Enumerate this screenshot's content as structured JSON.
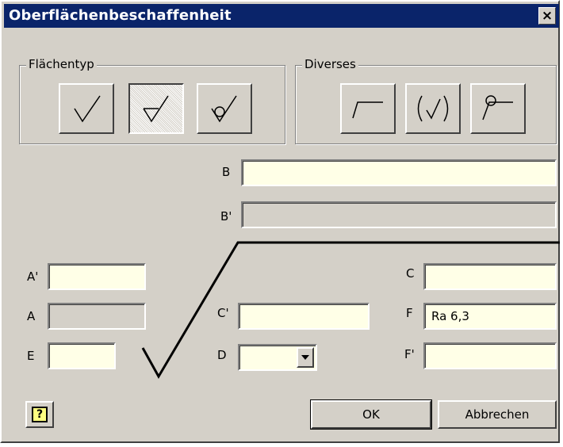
{
  "window": {
    "title": "Oberflächenbeschaffenheit",
    "close_label": "×"
  },
  "groups": {
    "surface_type": {
      "legend": "Flächentyp",
      "buttons": [
        {
          "icon": "basic-surface-symbol-icon",
          "pressed": false
        },
        {
          "icon": "material-removal-required-icon",
          "pressed": true
        },
        {
          "icon": "material-removal-prohibited-icon",
          "pressed": false
        }
      ]
    },
    "misc": {
      "legend": "Diverses",
      "buttons": [
        {
          "icon": "long-leg-symbol-icon"
        },
        {
          "icon": "standard-bracketed-symbol-icon"
        },
        {
          "icon": "all-around-symbol-icon"
        }
      ]
    }
  },
  "fields": {
    "B": {
      "label": "B",
      "value": ""
    },
    "B_prime": {
      "label": "B'",
      "value": ""
    },
    "A_prime": {
      "label": "A'",
      "value": ""
    },
    "A": {
      "label": "A",
      "value": ""
    },
    "E": {
      "label": "E",
      "value": ""
    },
    "C_prime": {
      "label": "C'",
      "value": ""
    },
    "D": {
      "label": "D",
      "value": ""
    },
    "C": {
      "label": "C",
      "value": ""
    },
    "F": {
      "label": "F",
      "value": "Ra 6,3"
    },
    "F_prime": {
      "label": "F'",
      "value": ""
    }
  },
  "buttons": {
    "help_label": "?",
    "ok_label": "OK",
    "cancel_label": "Abbrechen"
  },
  "colors": {
    "titlebar": "#0a246a",
    "field_background": "#ffffe7",
    "dialog_background": "#d4d0c8"
  }
}
